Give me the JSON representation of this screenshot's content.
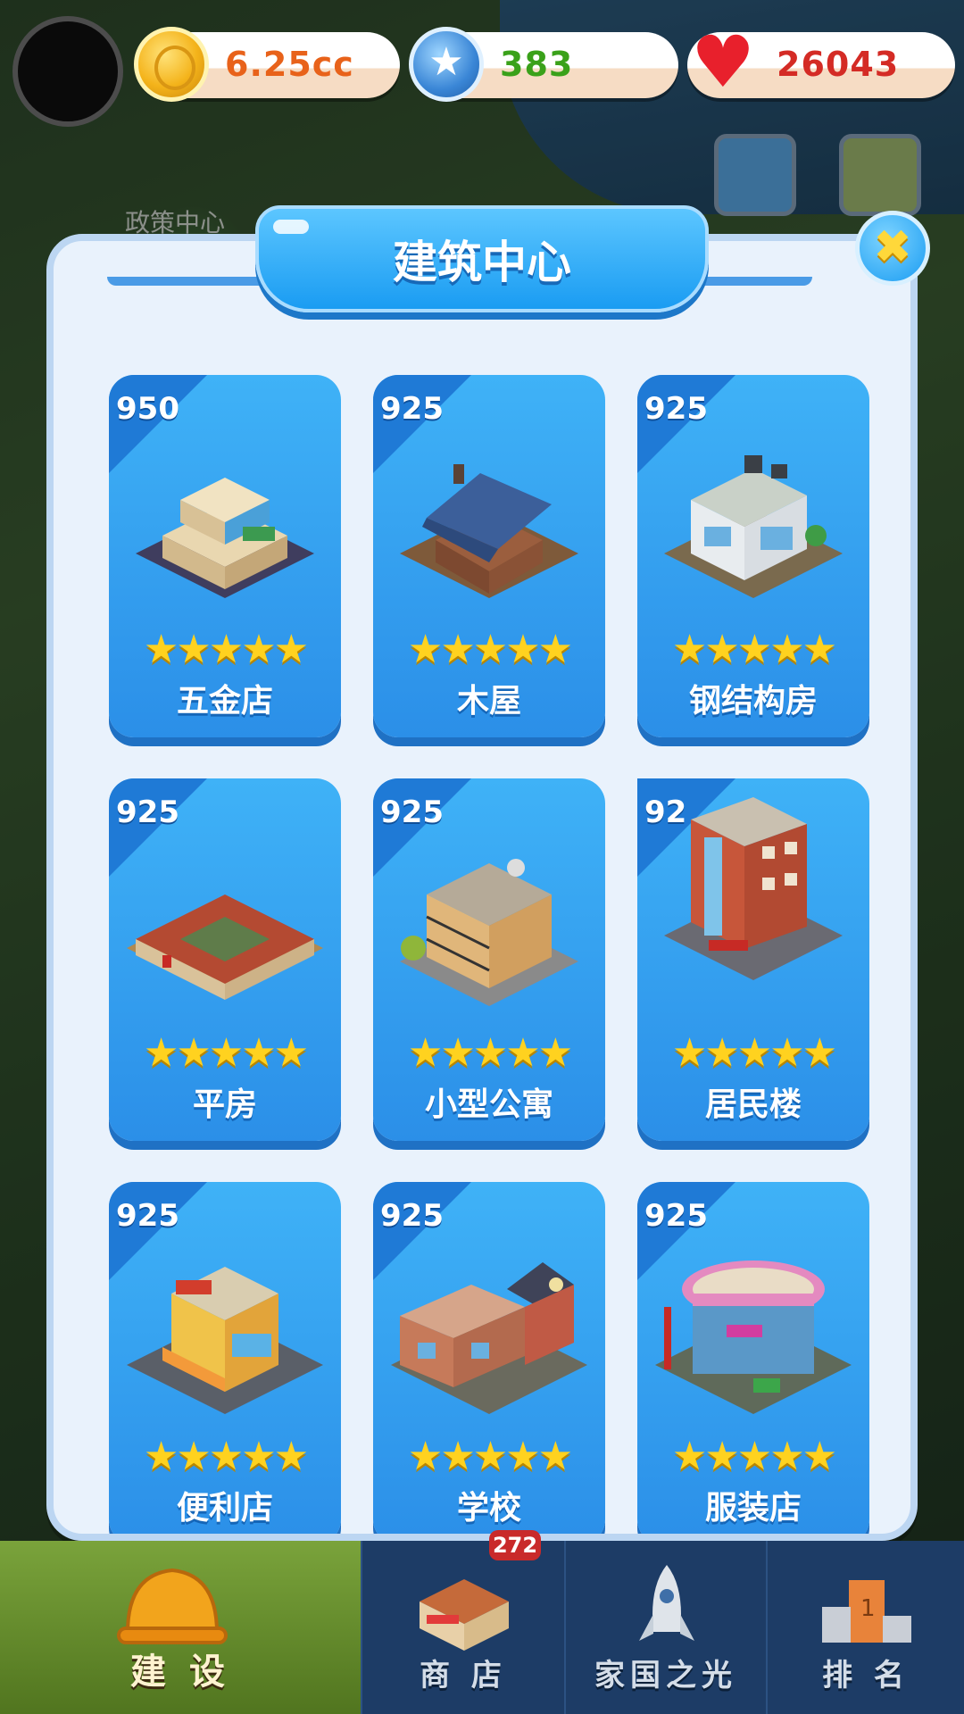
{
  "top_bar": {
    "coins": {
      "icon": "gold-coin-icon",
      "value": "6.25cc",
      "color": "#e8621a"
    },
    "gems": {
      "icon": "blue-star-gem-icon",
      "value": "383",
      "color": "#3aa11a"
    },
    "hearts": {
      "icon": "heart-icon",
      "value": "26043",
      "color": "#d42b25"
    }
  },
  "map_label": "政策中心",
  "panel": {
    "title": "建筑中心",
    "close_icon": "close-icon",
    "buildings": [
      {
        "price": "950",
        "stars": 5,
        "name": "五金店"
      },
      {
        "price": "925",
        "stars": 5,
        "name": "木屋"
      },
      {
        "price": "925",
        "stars": 5,
        "name": "钢结构房"
      },
      {
        "price": "925",
        "stars": 5,
        "name": "平房"
      },
      {
        "price": "925",
        "stars": 5,
        "name": "小型公寓"
      },
      {
        "price": "92",
        "stars": 5,
        "name": "居民楼"
      },
      {
        "price": "925",
        "stars": 5,
        "name": "便利店"
      },
      {
        "price": "925",
        "stars": 5,
        "name": "学校"
      },
      {
        "price": "925",
        "stars": 5,
        "name": "服装店"
      }
    ]
  },
  "bottom_nav": {
    "items": [
      {
        "label": "建 设",
        "icon": "hard-hat-icon",
        "active": true
      },
      {
        "label": "商 店",
        "icon": "shop-building-icon",
        "active": false
      },
      {
        "label": "家国之光",
        "icon": "rocket-icon",
        "active": false
      },
      {
        "label": "排 名",
        "icon": "podium-icon",
        "active": false
      }
    ],
    "shop_badge": "272"
  }
}
